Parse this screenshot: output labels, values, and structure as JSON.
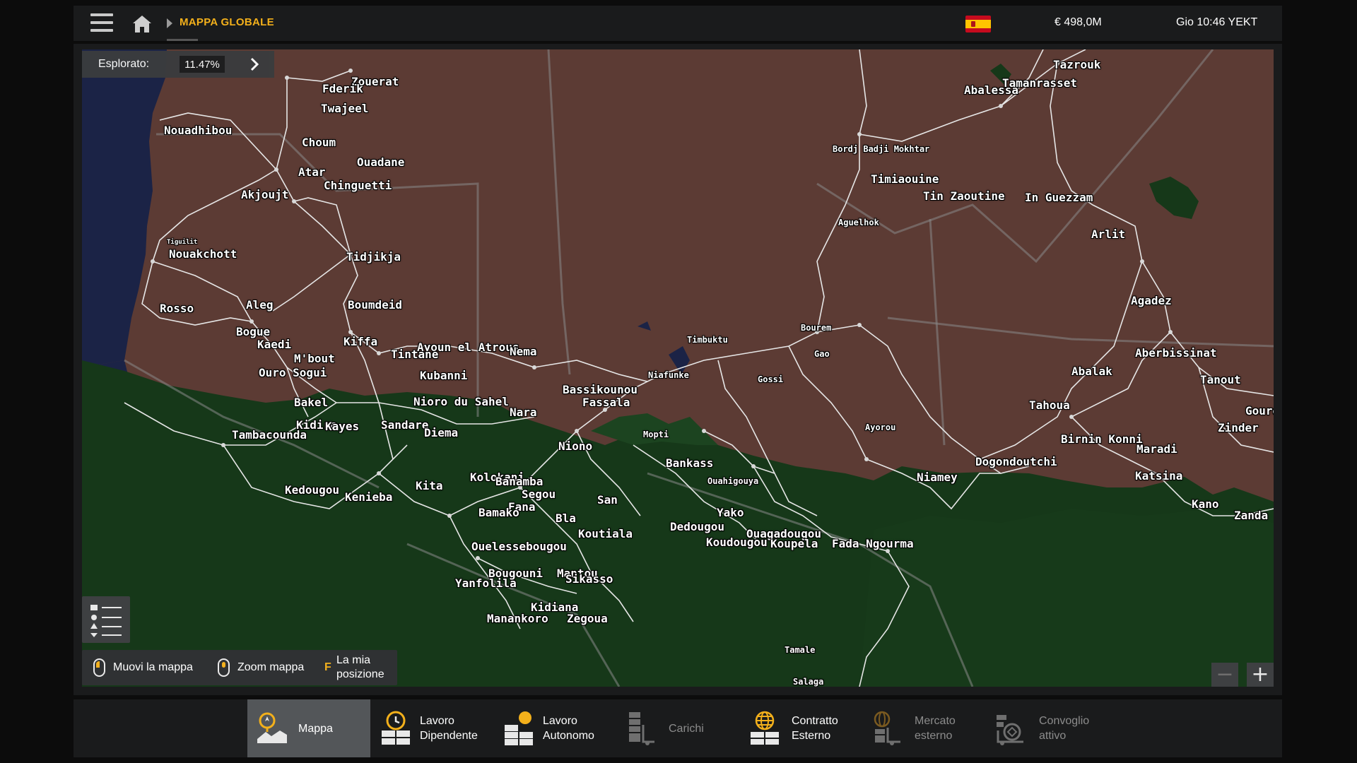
{
  "topbar": {
    "breadcrumb_title": "MAPPA GLOBALE",
    "money": "€ 498,0M",
    "clock": "Gio 10:46 YEKT"
  },
  "explored": {
    "label": "Esplorato:",
    "value": "11.47%"
  },
  "map": {
    "cities": [
      {
        "name": "Zouerat"
      },
      {
        "name": "Fderik"
      },
      {
        "name": "Twajeel"
      },
      {
        "name": "Nouadhibou"
      },
      {
        "name": "Choum"
      },
      {
        "name": "Ouadane"
      },
      {
        "name": "Atar"
      },
      {
        "name": "Chinguetti"
      },
      {
        "name": "Akjoujt"
      },
      {
        "name": "Nouakchott"
      },
      {
        "name": "Tidjikja"
      },
      {
        "name": "Rosso"
      },
      {
        "name": "Aleg"
      },
      {
        "name": "Boumdeid"
      },
      {
        "name": "Bogue"
      },
      {
        "name": "Kaedi"
      },
      {
        "name": "Kiffa"
      },
      {
        "name": "Ayoun el Atrous"
      },
      {
        "name": "Nema"
      },
      {
        "name": "Tintane"
      },
      {
        "name": "M'bout"
      },
      {
        "name": "Ouro Sogui"
      },
      {
        "name": "Kubanni"
      },
      {
        "name": "Bakel"
      },
      {
        "name": "Nioro du Sahel"
      },
      {
        "name": "Nara"
      },
      {
        "name": "Kidira"
      },
      {
        "name": "Kayes"
      },
      {
        "name": "Sandare"
      },
      {
        "name": "Tambacounda"
      },
      {
        "name": "Diema"
      },
      {
        "name": "Bassikounou"
      },
      {
        "name": "Fassala"
      },
      {
        "name": "Niafunke"
      },
      {
        "name": "Timbuktu"
      },
      {
        "name": "Gossi"
      },
      {
        "name": "Bourem"
      },
      {
        "name": "Gao"
      },
      {
        "name": "Mopti"
      },
      {
        "name": "Niono"
      },
      {
        "name": "Bankass"
      },
      {
        "name": "Kolokani"
      },
      {
        "name": "Banamba"
      },
      {
        "name": "Segou"
      },
      {
        "name": "Kedougou"
      },
      {
        "name": "Kenieba"
      },
      {
        "name": "Kita"
      },
      {
        "name": "Fana"
      },
      {
        "name": "San"
      },
      {
        "name": "Bamako"
      },
      {
        "name": "Bla"
      },
      {
        "name": "Koutiala"
      },
      {
        "name": "Ouahigouya"
      },
      {
        "name": "Yako"
      },
      {
        "name": "Dedougou"
      },
      {
        "name": "Ouagadougou"
      },
      {
        "name": "Koudougou"
      },
      {
        "name": "Koupela"
      },
      {
        "name": "Fada Ngourma"
      },
      {
        "name": "Ouelessebougou"
      },
      {
        "name": "Bougouni"
      },
      {
        "name": "Mantou"
      },
      {
        "name": "Yanfolila"
      },
      {
        "name": "Sikasso"
      },
      {
        "name": "Kidiana"
      },
      {
        "name": "Manankoro"
      },
      {
        "name": "Zegoua"
      },
      {
        "name": "Tamale"
      },
      {
        "name": "Salaga"
      },
      {
        "name": "Ayorou"
      },
      {
        "name": "Niamey"
      },
      {
        "name": "Dogondoutchi"
      },
      {
        "name": "Birnin Konni"
      },
      {
        "name": "Maradi"
      },
      {
        "name": "Katsina"
      },
      {
        "name": "Kano"
      },
      {
        "name": "Zinder"
      },
      {
        "name": "Tahoua"
      },
      {
        "name": "Abalak"
      },
      {
        "name": "Tanout"
      },
      {
        "name": "Aberbissinat"
      },
      {
        "name": "Agadez"
      },
      {
        "name": "Arlit"
      },
      {
        "name": "In Guezzam"
      },
      {
        "name": "Tin Zaoutine"
      },
      {
        "name": "Timiaouine"
      },
      {
        "name": "Bordj Badji Mokhtar"
      },
      {
        "name": "Aguelhok"
      },
      {
        "name": "Tazrouk"
      },
      {
        "name": "Abalessa"
      },
      {
        "name": "Tamanrasset"
      },
      {
        "name": "Goure"
      },
      {
        "name": "Zanda"
      },
      {
        "name": "Tiguilit"
      }
    ]
  },
  "hints": {
    "move": "Muovi la mappa",
    "zoom": "Zoom mappa",
    "my_position_key": "F",
    "my_position_line1": "La mia",
    "my_position_line2": "posizione"
  },
  "zoom": {
    "minus": "−",
    "plus": "+"
  },
  "nav": {
    "items": [
      {
        "line1": "Mappa",
        "line2": "",
        "icon": "map-icon",
        "active": true
      },
      {
        "line1": "Lavoro",
        "line2": "Dipendente",
        "icon": "job-clock-icon",
        "active": false
      },
      {
        "line1": "Lavoro",
        "line2": "Autonomo",
        "icon": "freight-icon",
        "active": false
      },
      {
        "line1": "Carichi",
        "line2": "",
        "icon": "cargo-icon",
        "active": false
      },
      {
        "line1": "Contratto",
        "line2": "Esterno",
        "icon": "external-contract-icon",
        "active": false
      },
      {
        "line1": "Mercato",
        "line2": "esterno",
        "icon": "external-market-icon",
        "active": false
      },
      {
        "line1": "Convoglio",
        "line2": "attivo",
        "icon": "convoy-icon",
        "active": false
      }
    ]
  },
  "colors": {
    "accent": "#f3b01b",
    "desert": "#5c3b34",
    "forest": "#163819",
    "ocean": "#1b2346",
    "road": "#e6e6e6"
  }
}
